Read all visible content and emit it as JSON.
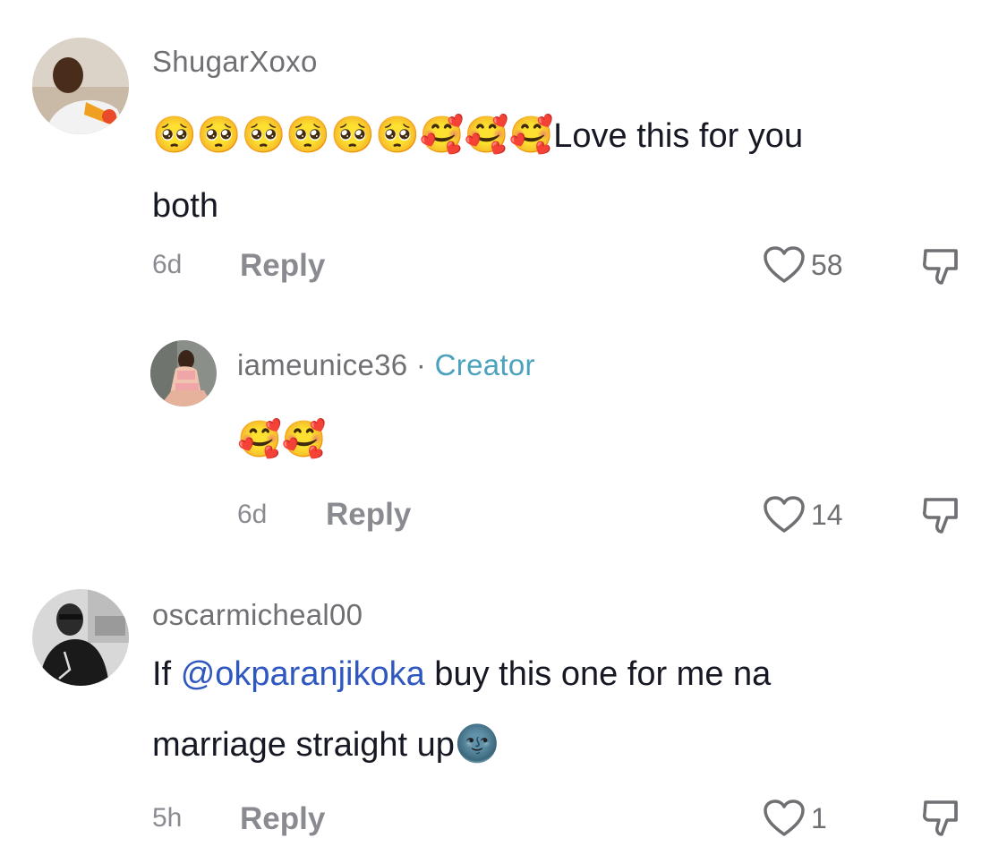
{
  "comments": [
    {
      "username": "ShugarXoxo",
      "text_line1_emoji": "🥺🥺🥺🥺🥺🥺🥰🥰🥰",
      "text_line1": "Love this for you",
      "text_line2": "both",
      "time": "6d",
      "reply_label": "Reply",
      "likes": "58"
    },
    {
      "username": "iameunice36",
      "separator": "·",
      "badge": "Creator",
      "emoji": "🥰🥰",
      "time": "6d",
      "reply_label": "Reply",
      "likes": "14"
    },
    {
      "username": "oscarmicheal00",
      "text_prefix": "If ",
      "mention": "@okparanjikoka",
      "text_after_mention": " buy this one for me na",
      "text_line2": "marriage straight up",
      "text_line2_emoji": "🌚",
      "time": "5h",
      "reply_label": "Reply",
      "likes": "1"
    }
  ],
  "icons": {
    "like": "heart-outline-icon",
    "dislike": "thumbs-down-icon"
  },
  "colors": {
    "username": "#6f6f74",
    "creator_badge": "#4aa2bd",
    "mention": "#2f57c0",
    "text": "#161823",
    "meta": "#8a8b91"
  }
}
